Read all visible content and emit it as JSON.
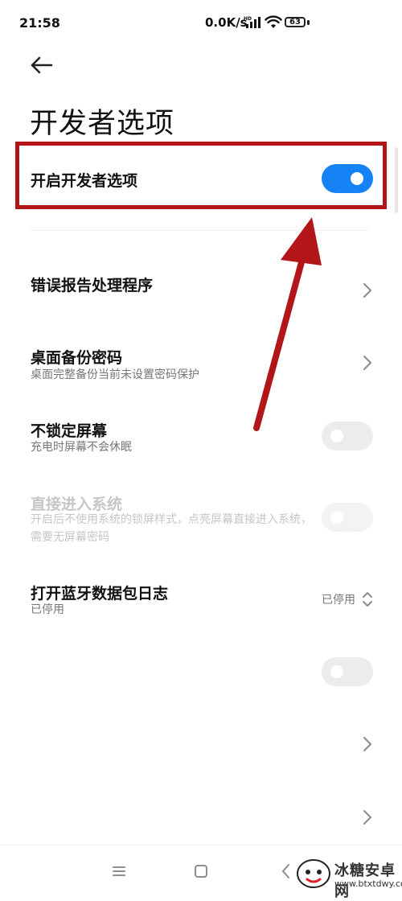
{
  "status_bar": {
    "time": "21:58",
    "net_speed": "0.0K/s",
    "battery": "63",
    "icons": [
      "hd-signal-icon",
      "wifi-icon",
      "battery-icon"
    ]
  },
  "page": {
    "title": "开发者选项",
    "back_icon": "arrow-left-icon"
  },
  "settings": {
    "master": {
      "title": "开启开发者选项",
      "toggle_on": true
    },
    "bug_report": {
      "title": "错误报告处理程序"
    },
    "desktop_backup": {
      "title": "桌面备份密码",
      "subtitle": "桌面完整备份当前未设置密码保护"
    },
    "stay_awake": {
      "title": "不锁定屏幕",
      "subtitle": "充电时屏幕不会休眠",
      "toggle_on": false
    },
    "direct_enter": {
      "title": "直接进入系统",
      "subtitle": "开启后不使用系统的锁屏样式，点亮屏幕直接进入系统，需要无屏幕密码",
      "toggle_on": false,
      "enabled": false
    },
    "bt_hci_log": {
      "title": "打开蓝牙数据包日志",
      "subtitle": "已停用",
      "value": "已停用"
    },
    "row7": {
      "toggle_on": false
    }
  },
  "nav_bar": {
    "icons": [
      "menu-icon",
      "home-icon",
      "back-icon"
    ]
  },
  "annotation": {
    "highlight_color": "#b3161a",
    "arrow_color": "#b3161a"
  },
  "watermark": {
    "name": "冰糖安卓网",
    "url": "www.btxtdwy.com"
  },
  "colors": {
    "accent": "#1582f5",
    "toggle_off": "#ececec"
  }
}
